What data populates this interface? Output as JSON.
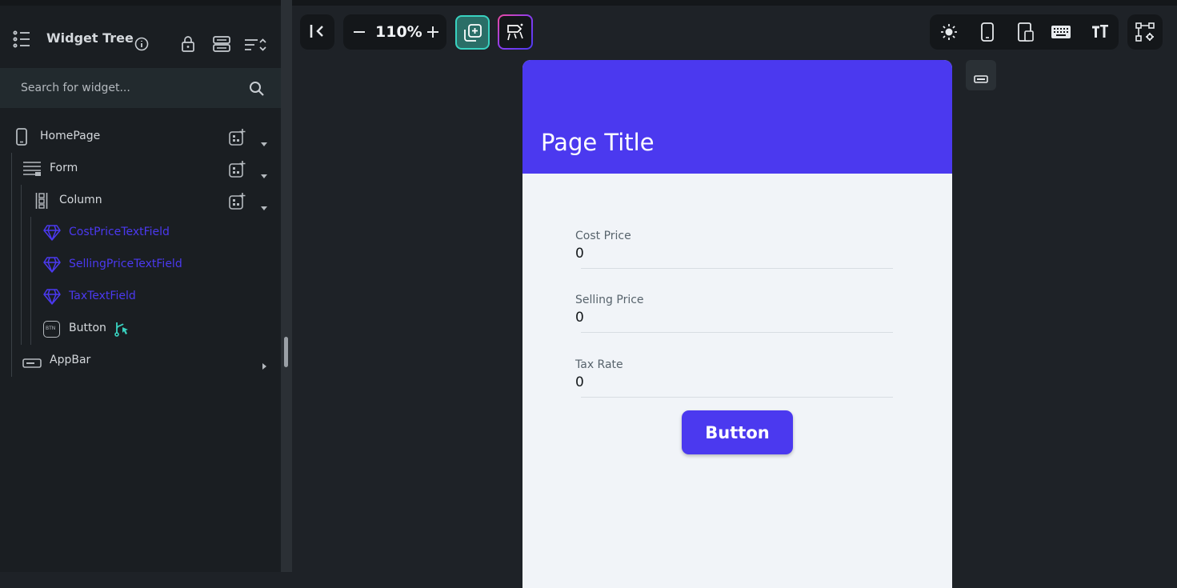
{
  "sidebar": {
    "title": "Widget Tree",
    "search_placeholder": "Search for widget...",
    "tree": [
      {
        "label": "HomePage",
        "icon": "phone-icon",
        "has_add": true,
        "has_dropdown": true
      },
      {
        "label": "Form",
        "icon": "form-icon",
        "has_add": true,
        "has_dropdown": true
      },
      {
        "label": "Column",
        "icon": "column-icon",
        "has_add": true,
        "has_dropdown": true
      },
      {
        "label": "CostPriceTextField",
        "icon": "component-gem-icon"
      },
      {
        "label": "SellingPriceTextField",
        "icon": "component-gem-icon"
      },
      {
        "label": "TaxTextField",
        "icon": "component-gem-icon"
      },
      {
        "label": "Button",
        "icon": "button-btn-icon",
        "has_action": true
      },
      {
        "label": "AppBar",
        "icon": "appbar-icon",
        "has_expand": true
      }
    ],
    "button_icon_text": "BTN"
  },
  "toolbar": {
    "zoom": "110%"
  },
  "preview": {
    "page_title": "Page Title",
    "fields": [
      {
        "label": "Cost Price",
        "value": "0"
      },
      {
        "label": "Selling Price",
        "value": "0"
      },
      {
        "label": "Tax Rate",
        "value": "0"
      }
    ],
    "button_label": "Button"
  },
  "colors": {
    "primary": "#4b39ef",
    "teal_accent": "#39d2c0",
    "panel_bg": "#1a1e22",
    "canvas_bg": "#1e2227"
  }
}
